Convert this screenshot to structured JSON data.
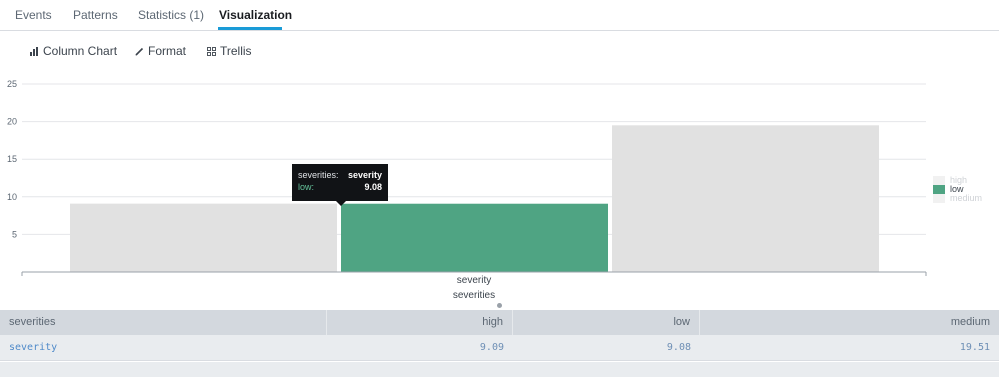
{
  "tabs": [
    {
      "label": "Events"
    },
    {
      "label": "Patterns"
    },
    {
      "label": "Statistics (1)"
    },
    {
      "label": "Visualization",
      "active": true
    }
  ],
  "toolbar": {
    "column_chart": "Column Chart",
    "format": "Format",
    "trellis": "Trellis"
  },
  "colors": {
    "accent": "#1a9bd7",
    "highlight_series": "#4fa483",
    "dimmed_series": "#e1e1e1"
  },
  "chart_data": {
    "type": "bar",
    "categories": [
      "severity"
    ],
    "series": [
      {
        "name": "high",
        "values": [
          9.09
        ]
      },
      {
        "name": "low",
        "values": [
          9.08
        ]
      },
      {
        "name": "medium",
        "values": [
          19.51
        ]
      }
    ],
    "highlighted_series": "low",
    "xlabel": "severities",
    "ylabel": "",
    "ylim": [
      0,
      25
    ],
    "yticks": [
      5,
      10,
      15,
      20,
      25
    ],
    "grid": true,
    "legend": "right"
  },
  "tooltip": {
    "field_label": "severities:",
    "field_value": "severity",
    "series_label": "low:",
    "series_value": "9.08"
  },
  "table": {
    "columns": [
      "severities",
      "high",
      "low",
      "medium"
    ],
    "rows": [
      [
        "severity",
        "9.09",
        "9.08",
        "19.51"
      ]
    ]
  }
}
